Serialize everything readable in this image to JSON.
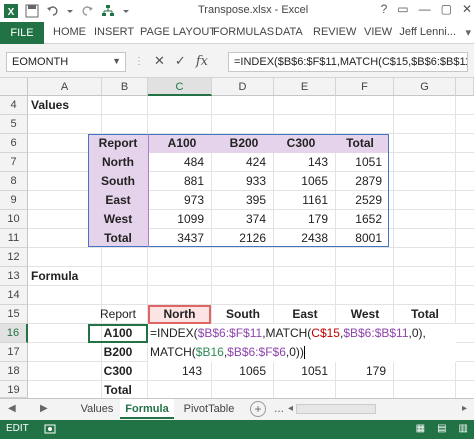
{
  "window": {
    "title": "Transpose.xlsx - Excel",
    "buttons": [
      "?",
      "▭",
      "—",
      "▢",
      "✕"
    ]
  },
  "ribbon": {
    "file": "FILE",
    "tabs": [
      "HOME",
      "INSERT",
      "PAGE LAYOUT",
      "FORMULAS",
      "DATA",
      "REVIEW",
      "VIEW"
    ],
    "user": "Jeff Lenni..."
  },
  "formula_bar": {
    "name_box": "EOMONTH",
    "cancel": "✕",
    "enter": "✓",
    "fx": "fx",
    "formula": "=INDEX($B$6:$F$11,MATCH(C$15,$B$6:$B$11,0),"
  },
  "grid": {
    "columns": [
      "A",
      "B",
      "C",
      "D",
      "E",
      "F",
      "G"
    ],
    "selected_column": "C",
    "rows": [
      "4",
      "5",
      "6",
      "7",
      "8",
      "9",
      "10",
      "11",
      "12",
      "13",
      "14",
      "15",
      "16",
      "17",
      "18",
      "19"
    ],
    "selected_row": "16"
  },
  "cells": {
    "A4": "Values",
    "A13": "Formula",
    "values_table": {
      "headers": [
        "Report",
        "A100",
        "B200",
        "C300",
        "Total"
      ],
      "rows": [
        [
          "North",
          "484",
          "424",
          "143",
          "1051"
        ],
        [
          "South",
          "881",
          "933",
          "1065",
          "2879"
        ],
        [
          "East",
          "973",
          "395",
          "1161",
          "2529"
        ],
        [
          "West",
          "1099",
          "374",
          "179",
          "1652"
        ],
        [
          "Total",
          "3437",
          "2126",
          "2438",
          "8001"
        ]
      ]
    },
    "formula_table": {
      "headers": [
        "Report",
        "North",
        "South",
        "East",
        "West",
        "Total"
      ],
      "row_labels": [
        "A100",
        "B200",
        "C300",
        "Total"
      ],
      "row18_values": [
        "143",
        "1065",
        "1051",
        "179"
      ]
    },
    "edit_line1": {
      "p1": "=INDEX(",
      "p2": "$B$6:$F$11",
      "p3": ",MATCH(",
      "p4": "C$15",
      "p5": ",",
      "p6": "$B$6:$B$11",
      "p7": ",0),"
    },
    "edit_line2": {
      "p1": "MATCH(",
      "p2": "$B16",
      "p3": ",",
      "p4": "$B$6:$F$6",
      "p5": ",0))"
    }
  },
  "sheets": {
    "tabs": [
      "Values",
      "Formula",
      "PivotTable"
    ],
    "active": "Formula",
    "add": "+",
    "nav_prev": "◀",
    "nav_next": "▶",
    "more": "..."
  },
  "status": {
    "mode": "EDIT",
    "macro_icon": "macro-record-icon"
  },
  "colors": {
    "excel_green": "#217346",
    "table_header": "#e4d3ea",
    "table_border": "#4472c4",
    "ref_red": "#c00000",
    "ref_blue": "#3d6fc4",
    "ref_purple": "#8e44ad"
  }
}
